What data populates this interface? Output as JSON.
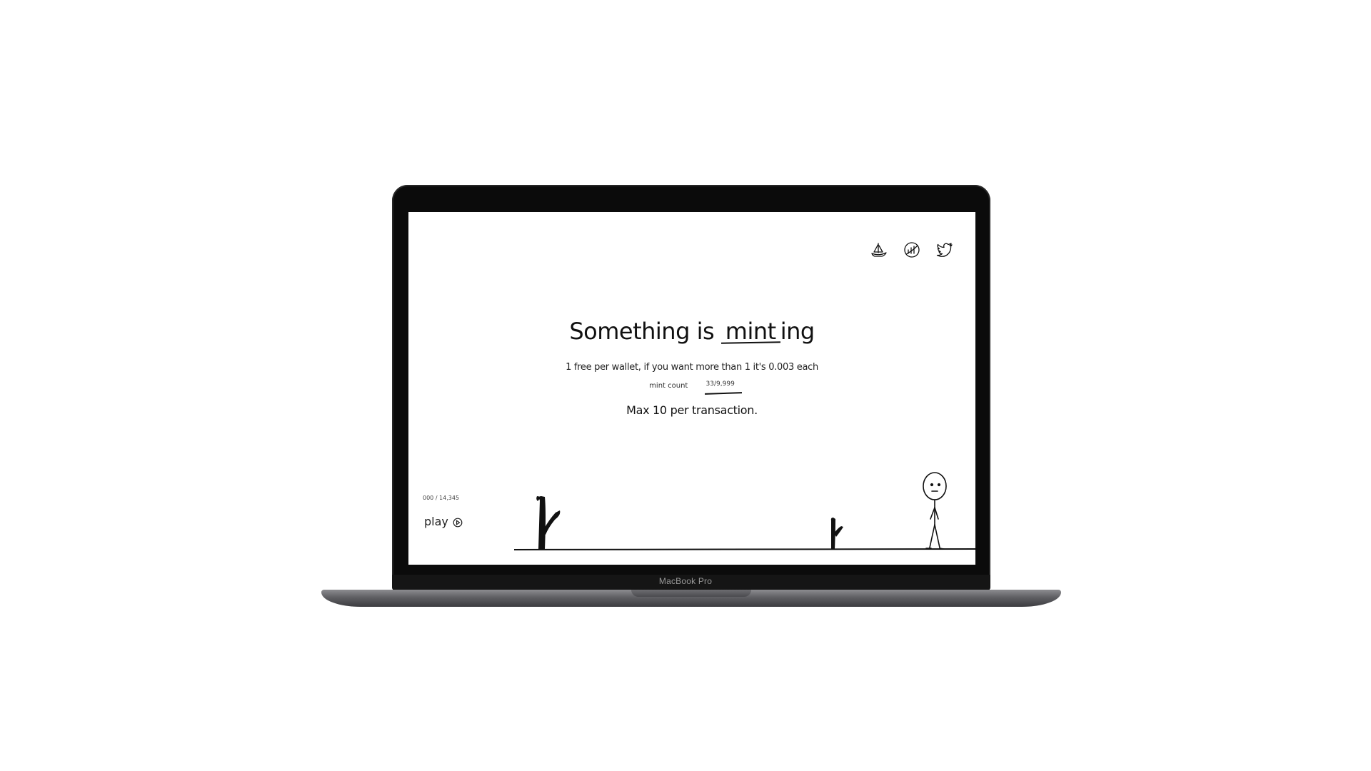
{
  "device": {
    "brand_label": "MacBook Pro"
  },
  "social_icons": [
    {
      "icon": "opensea-boat-icon"
    },
    {
      "icon": "etherscan-chart-icon"
    },
    {
      "icon": "twitter-bird-icon"
    }
  ],
  "hero": {
    "headline_prefix": "Something is",
    "headline_highlight": "mint",
    "headline_suffix": "ing",
    "price_note": "1 free per wallet, if you want more than 1 it's 0.003 each",
    "mint_count_label": "mint count",
    "mint_count_value": "33/9,999",
    "max_per_tx": "Max 10 per transaction."
  },
  "game": {
    "score": "000 / 14,345",
    "play_label": "play",
    "play_icon": "play-circle-icon"
  }
}
